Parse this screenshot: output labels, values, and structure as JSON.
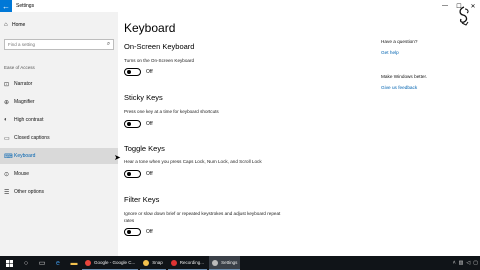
{
  "window": {
    "title": "Settings"
  },
  "titlebar": {
    "back_icon": "back-arrow-icon",
    "minimize": "—",
    "maximize": "☐",
    "close": "✕"
  },
  "sidebar": {
    "home_label": "Home",
    "search_placeholder": "Find a setting",
    "section_label": "Ease of Access",
    "items": [
      {
        "label": "Narrator",
        "icon": "narrator-icon",
        "glyph": "⊡"
      },
      {
        "label": "Magnifier",
        "icon": "magnifier-icon",
        "glyph": "⊕"
      },
      {
        "label": "High contrast",
        "icon": "high-contrast-icon",
        "glyph": "◐"
      },
      {
        "label": "Closed captions",
        "icon": "closed-captions-icon",
        "glyph": "▭"
      },
      {
        "label": "Keyboard",
        "icon": "keyboard-icon",
        "glyph": "⌨",
        "active": true
      },
      {
        "label": "Mouse",
        "icon": "mouse-icon",
        "glyph": "⊙"
      },
      {
        "label": "Other options",
        "icon": "other-options-icon",
        "glyph": "☰"
      }
    ]
  },
  "main": {
    "title": "Keyboard",
    "sections": [
      {
        "heading": "On-Screen Keyboard",
        "description": "Turns on the On-Screen Keyboard",
        "state": "Off"
      },
      {
        "heading": "Sticky Keys",
        "description": "Press one key at a time for keyboard shortcuts",
        "state": "Off"
      },
      {
        "heading": "Toggle Keys",
        "description": "Hear a tone when you press Caps Lock, Num Lock, and Scroll Lock",
        "state": "Off"
      },
      {
        "heading": "Filter Keys",
        "description": "Ignore or slow down brief or repeated keystrokes and adjust keyboard repeat rates",
        "state": "Off"
      }
    ]
  },
  "right_panel": {
    "question": "Have a question?",
    "get_help": "Get help",
    "make_better": "Make Windows better.",
    "feedback": "Give us feedback"
  },
  "taskbar": {
    "tasks": [
      {
        "label": "Google - Google C...",
        "icon": "chrome-icon",
        "color": "#e8453c"
      },
      {
        "label": "Snap",
        "icon": "folder-icon",
        "color": "#f2c14e"
      },
      {
        "label": "Recording...",
        "icon": "recorder-icon",
        "color": "#d33"
      },
      {
        "label": "Settings",
        "icon": "settings-gear-icon",
        "color": "#bbb",
        "active": true
      }
    ]
  },
  "colors": {
    "accent": "#0078d7",
    "link": "#0063b1",
    "sidebar_bg": "#f2f2f2",
    "taskbar_bg": "#101418"
  }
}
